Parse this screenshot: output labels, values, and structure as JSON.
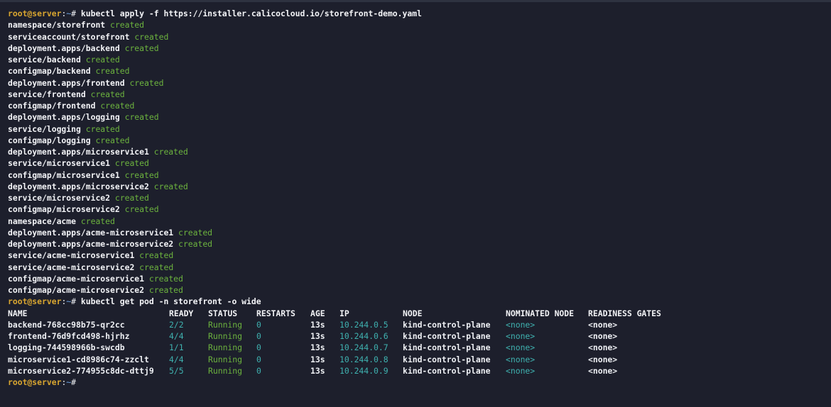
{
  "prompt": {
    "user_host": "root@server",
    "separator": ":",
    "path": "~",
    "symbol": "# "
  },
  "commands": {
    "apply": "kubectl apply -f https://installer.calicocloud.io/storefront-demo.yaml",
    "get": "kubectl get pod -n storefront -o wide"
  },
  "created_word": "created",
  "created_resources": [
    "namespace/storefront",
    "serviceaccount/storefront",
    "deployment.apps/backend",
    "service/backend",
    "configmap/backend",
    "deployment.apps/frontend",
    "service/frontend",
    "configmap/frontend",
    "deployment.apps/logging",
    "service/logging",
    "configmap/logging",
    "deployment.apps/microservice1",
    "service/microservice1",
    "configmap/microservice1",
    "deployment.apps/microservice2",
    "service/microservice2",
    "configmap/microservice2",
    "namespace/acme",
    "deployment.apps/acme-microservice1",
    "deployment.apps/acme-microservice2",
    "service/acme-microservice1",
    "service/acme-microservice2",
    "configmap/acme-microservice1",
    "configmap/acme-microservice2"
  ],
  "pod_table": {
    "headers": [
      "NAME",
      "READY",
      "STATUS",
      "RESTARTS",
      "AGE",
      "IP",
      "NODE",
      "NOMINATED NODE",
      "READINESS GATES"
    ],
    "rows": [
      [
        "backend-768cc98b75-qr2cc",
        "2/2",
        "Running",
        "0",
        "13s",
        "10.244.0.5",
        "kind-control-plane",
        "<none>",
        "<none>"
      ],
      [
        "frontend-76d9fcd498-hjrhz",
        "4/4",
        "Running",
        "0",
        "13s",
        "10.244.0.6",
        "kind-control-plane",
        "<none>",
        "<none>"
      ],
      [
        "logging-744598966b-swcdb",
        "1/1",
        "Running",
        "0",
        "13s",
        "10.244.0.7",
        "kind-control-plane",
        "<none>",
        "<none>"
      ],
      [
        "microservice1-cd8986c74-zzclt",
        "4/4",
        "Running",
        "0",
        "13s",
        "10.244.0.8",
        "kind-control-plane",
        "<none>",
        "<none>"
      ],
      [
        "microservice2-774955c8dc-dttj9",
        "5/5",
        "Running",
        "0",
        "13s",
        "10.244.0.9",
        "kind-control-plane",
        "<none>",
        "<none>"
      ]
    ]
  },
  "colors": {
    "background": "#1d1f2c",
    "prompt_user": "#d9a630",
    "prompt_path": "#6fa8e8",
    "created": "#6cb33e",
    "teal_values": "#3fb2b0",
    "text": "#eef0f4"
  }
}
